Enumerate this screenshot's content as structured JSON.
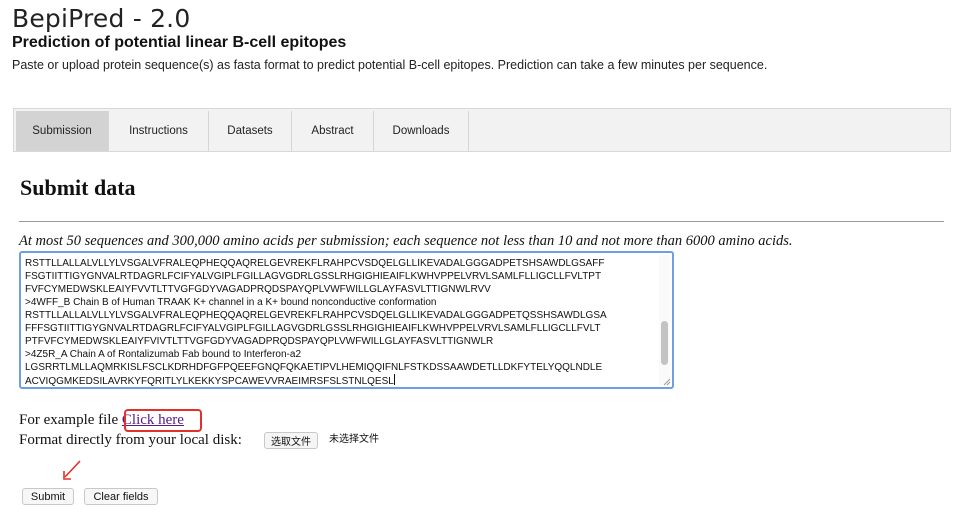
{
  "header": {
    "logo": "BepiPred - 2.0",
    "subtitle": "Prediction of potential linear B-cell epitopes",
    "description": "Paste or upload protein sequence(s) as fasta format to predict potential B-cell epitopes. Prediction can take a few minutes per sequence."
  },
  "tabs": [
    {
      "label": "Submission",
      "active": true
    },
    {
      "label": "Instructions",
      "active": false
    },
    {
      "label": "Datasets",
      "active": false
    },
    {
      "label": "Abstract",
      "active": false
    },
    {
      "label": "Downloads",
      "active": false
    }
  ],
  "main": {
    "title": "Submit data",
    "limits": "At most 50 sequences and 300,000 amino acids per submission; each sequence not less than 10 and not more than 6000 amino acids."
  },
  "sequence_input": {
    "lines": [
      "RSTTLLALLALVLLYLVSGALVFRALEQPHEQQAQRELGEVREKFLRAHPCVSDQELGLLIKEVADALGGGADPETSHSAWDLGSAFF",
      "FSGTIITTIGYGNVALRTDAGRLFCIFYALVGIPLFGILLAGVGDRLGSSLRHGIGHIEAIFLKWHVPPELVRVLSAMLFLLIGCLLFVLTPT",
      "FVFCYMEDWSKLEAIYFVVTLTTVGFGDYVAGADPRQDSPAYQPLVWFWILLGLAYFASVLTTIGNWLRVV",
      ">4WFF_B Chain B of Human TRAAK K+ channel in a K+ bound nonconductive conformation",
      "RSTTLLALLALVLLYLVSGALVFRALEQPHEQQAQRELGEVREKFLRAHPCVSDQELGLLIKEVADALGGGADPETQSSHSAWDLGSA",
      "FFFSGTIITTIGYGNVALRTDAGRLFCIFYALVGIPLFGILLAGVGDRLGSSLRHGIGHIEAIFLKWHVPPELVRVLSAMLFLLIGCLLFVLT",
      "PTFVFCYMEDWSKLEAIYFVIVTLTTVGFGDYVAGADPRQDSPAYQPLVWFWILLGLAYFASVLTTIGNWLR",
      ">4Z5R_A Chain A of Rontalizumab Fab bound to Interferon-a2",
      "LGSRRTLMLLAQMRKISLFSCLKDRHDFGFPQEEFGNQFQKAETIPVLHEMIQQIFNLFSTKDSSAAWDETLLDKFYTELYQQLNDLE",
      "ACVIQGMKEDSILAVRKYFQRITLYLKEKKYSPCAWEVVRAEIMRSFSLSTNLQESL"
    ]
  },
  "example": {
    "prefix": "For example file",
    "link": "Click here"
  },
  "upload": {
    "label": "Format directly from your local disk:",
    "button": "选取文件",
    "status": "未选择文件"
  },
  "actions": {
    "submit": "Submit",
    "clear": "Clear fields"
  },
  "colors": {
    "highlight": "#e0322b",
    "textarea_border": "#6e9fe0",
    "link": "#551a8b"
  }
}
